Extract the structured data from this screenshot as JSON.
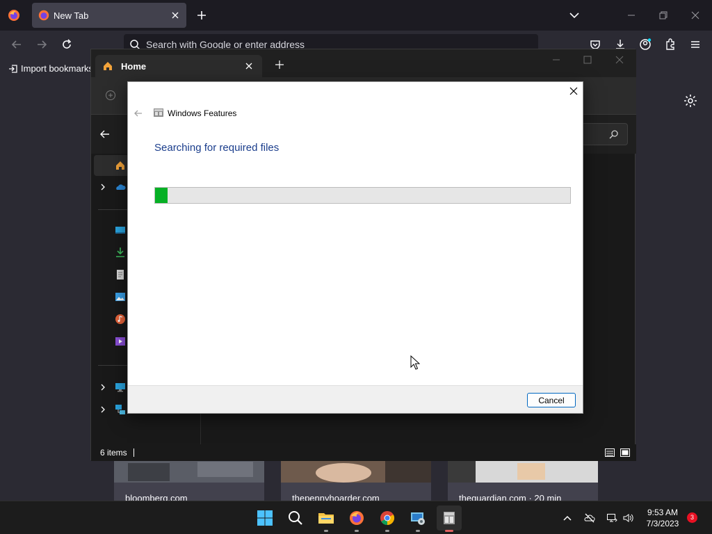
{
  "firefox": {
    "tab": {
      "title": "New Tab"
    },
    "urlbar": {
      "placeholder": "Search with Google or enter address"
    },
    "bookmarks": {
      "import_label": "Import bookmarks"
    },
    "tiles": [
      {
        "label": "bloomberg.com"
      },
      {
        "label": "thepennyhoarder.com"
      },
      {
        "label": "theguardian.com · 20 min"
      }
    ]
  },
  "explorer": {
    "tab": {
      "title": "Home"
    },
    "status": {
      "item_count": "6 items"
    }
  },
  "dialog": {
    "title": "Windows Features",
    "heading": "Searching for required files",
    "progress_percent": 3,
    "cancel_label": "Cancel"
  },
  "taskbar": {
    "time": "9:53 AM",
    "date": "7/3/2023",
    "notification_count": "3"
  },
  "colors": {
    "progress_green": "#06b025",
    "heading_blue": "#1a3d8c",
    "firefox_dark": "#1c1b22",
    "explorer_dark": "#191919"
  }
}
